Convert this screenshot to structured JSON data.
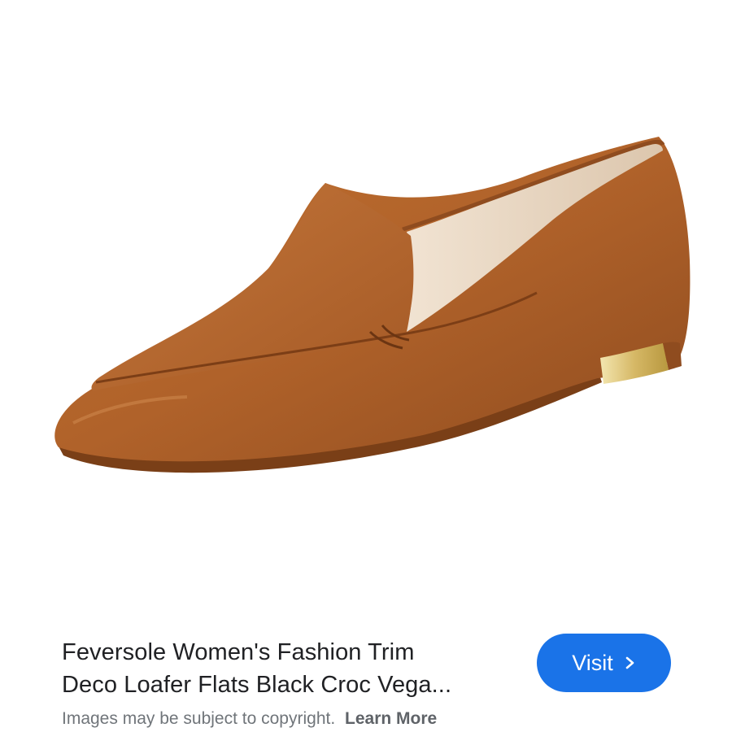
{
  "product": {
    "image_alt": "Feversole Women's Fashion Trim Deco Loafer Flats",
    "title_line1": "Feversole Women's Fashion Trim",
    "title_line2": "Deco Loafer Flats Black Croc Vega..."
  },
  "visit": {
    "label": "Visit",
    "icon": "chevron-right-icon"
  },
  "footer": {
    "copyright_text": "Images may be subject to copyright.",
    "learn_more": "Learn More"
  },
  "colors": {
    "visit_button": "#1a73e8",
    "shoe_leather": "#b5652a",
    "shoe_lining": "#e9d8c4",
    "heel_trim": "#d9c27a"
  }
}
